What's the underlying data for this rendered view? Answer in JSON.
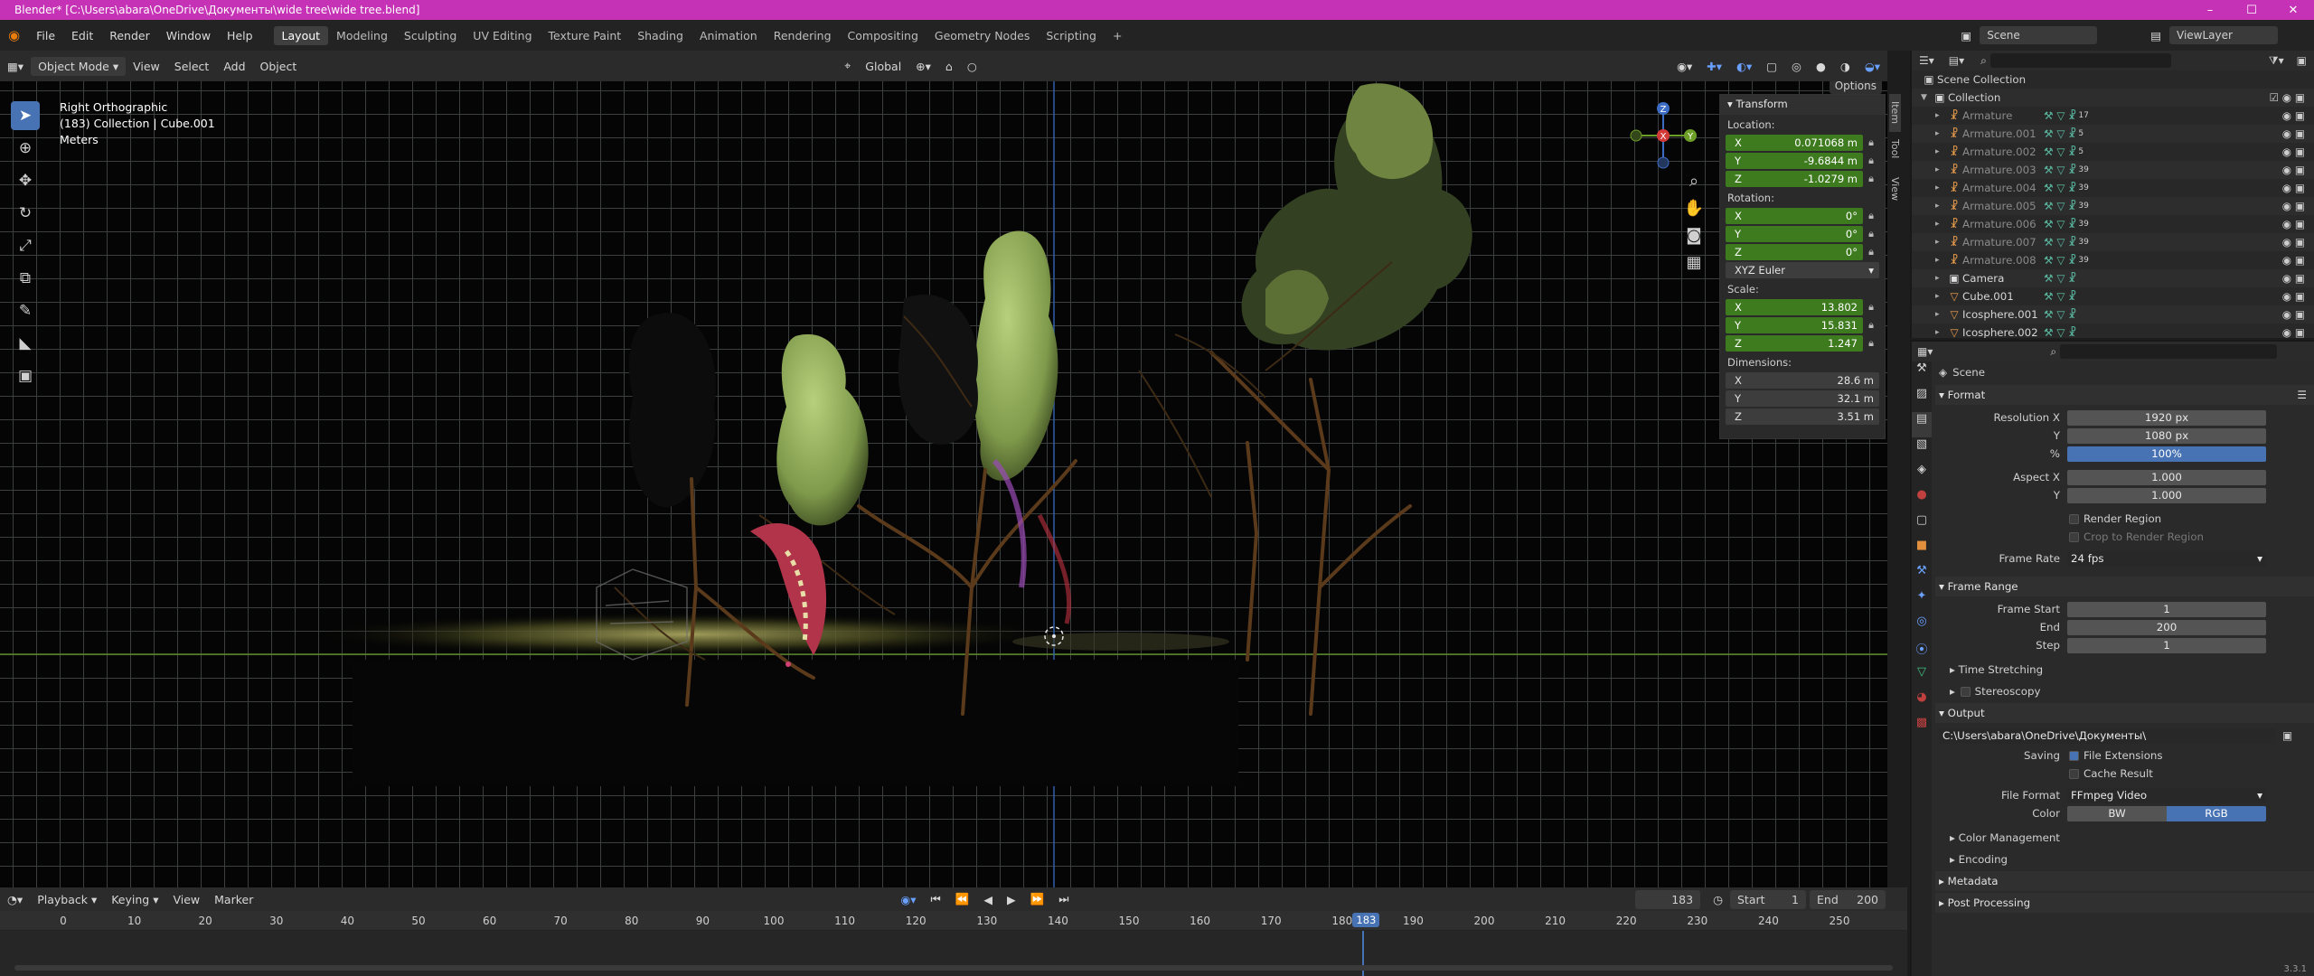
{
  "window": {
    "title": "Blender* [C:\\Users\\abara\\OneDrive\\Документы\\wide tree\\wide tree.blend]"
  },
  "menu": [
    "File",
    "Edit",
    "Render",
    "Window",
    "Help"
  ],
  "workspaces": [
    "Layout",
    "Modeling",
    "Sculpting",
    "UV Editing",
    "Texture Paint",
    "Shading",
    "Animation",
    "Rendering",
    "Compositing",
    "Geometry Nodes",
    "Scripting"
  ],
  "scene_field": "Scene",
  "viewlayer_field": "ViewLayer",
  "header3d": {
    "mode": "Object Mode",
    "menus": [
      "View",
      "Select",
      "Add",
      "Object"
    ],
    "transform_orientation": "Global",
    "options": "Options"
  },
  "viewport": {
    "view_name": "Right Orthographic",
    "collection_info": "(183) Collection | Cube.001",
    "units": "Meters"
  },
  "gizmo": {
    "z": "Z",
    "y": "Y",
    "x": "X"
  },
  "npanel": {
    "title": "Transform",
    "location_label": "Location:",
    "location": {
      "x": "0.071068 m",
      "y": "-9.6844 m",
      "z": "-1.0279 m"
    },
    "rotation_label": "Rotation:",
    "rotation": {
      "x": "0°",
      "y": "0°",
      "z": "0°"
    },
    "rotation_mode": "XYZ Euler",
    "scale_label": "Scale:",
    "scale": {
      "x": "13.802",
      "y": "15.831",
      "z": "1.247"
    },
    "dimensions_label": "Dimensions:",
    "dimensions": {
      "x": "28.6 m",
      "y": "32.1 m",
      "z": "3.51 m"
    },
    "axes": [
      "X",
      "Y",
      "Z"
    ],
    "tabs": [
      "Item",
      "Tool",
      "View"
    ]
  },
  "timeline": {
    "menus": [
      "Playback",
      "Keying",
      "View",
      "Marker"
    ],
    "current_frame": "183",
    "start_label": "Start",
    "start": "1",
    "end_label": "End",
    "end": "200",
    "ticks": [
      "0",
      "10",
      "20",
      "30",
      "40",
      "50",
      "60",
      "70",
      "80",
      "90",
      "100",
      "110",
      "120",
      "130",
      "140",
      "150",
      "160",
      "170",
      "180",
      "190",
      "200",
      "210",
      "220",
      "230",
      "240",
      "250"
    ],
    "playhead": "183"
  },
  "outliner": {
    "scene_collection": "Scene Collection",
    "collection": "Collection",
    "items": [
      {
        "name": "Armature",
        "count": "17"
      },
      {
        "name": "Armature.001",
        "count": "5"
      },
      {
        "name": "Armature.002",
        "count": "5"
      },
      {
        "name": "Armature.003",
        "count": "39"
      },
      {
        "name": "Armature.004",
        "count": "39"
      },
      {
        "name": "Armature.005",
        "count": "39"
      },
      {
        "name": "Armature.006",
        "count": "39"
      },
      {
        "name": "Armature.007",
        "count": "39"
      },
      {
        "name": "Armature.008",
        "count": "39"
      },
      {
        "name": "Camera",
        "count": ""
      },
      {
        "name": "Cube.001",
        "count": ""
      },
      {
        "name": "Icosphere.001",
        "count": ""
      },
      {
        "name": "Icosphere.002",
        "count": ""
      }
    ]
  },
  "properties": {
    "context": "Scene",
    "format": {
      "title": "Format",
      "resolution_x_label": "Resolution X",
      "resolution_x": "1920 px",
      "y_label": "Y",
      "resolution_y": "1080 px",
      "percent_label": "%",
      "percent": "100%",
      "aspect_x_label": "Aspect X",
      "aspect_x": "1.000",
      "aspect_y_label": "Y",
      "aspect_y": "1.000",
      "render_region": "Render Region",
      "crop": "Crop to Render Region",
      "frame_rate_label": "Frame Rate",
      "frame_rate": "24 fps"
    },
    "frame_range": {
      "title": "Frame Range",
      "start_label": "Frame Start",
      "start": "1",
      "end_label": "End",
      "end": "200",
      "step_label": "Step",
      "step": "1"
    },
    "time_stretching": "Time Stretching",
    "stereoscopy": "Stereoscopy",
    "output": {
      "title": "Output",
      "path": "C:\\Users\\abara\\OneDrive\\Документы\\",
      "saving_label": "Saving",
      "file_extensions": "File Extensions",
      "cache_result": "Cache Result",
      "file_format_label": "File Format",
      "file_format": "FFmpeg Video",
      "color_label": "Color",
      "bw": "BW",
      "rgb": "RGB"
    },
    "color_management": "Color Management",
    "encoding": "Encoding",
    "metadata": "Metadata",
    "post_processing": "Post Processing"
  },
  "version": "3.3.1"
}
